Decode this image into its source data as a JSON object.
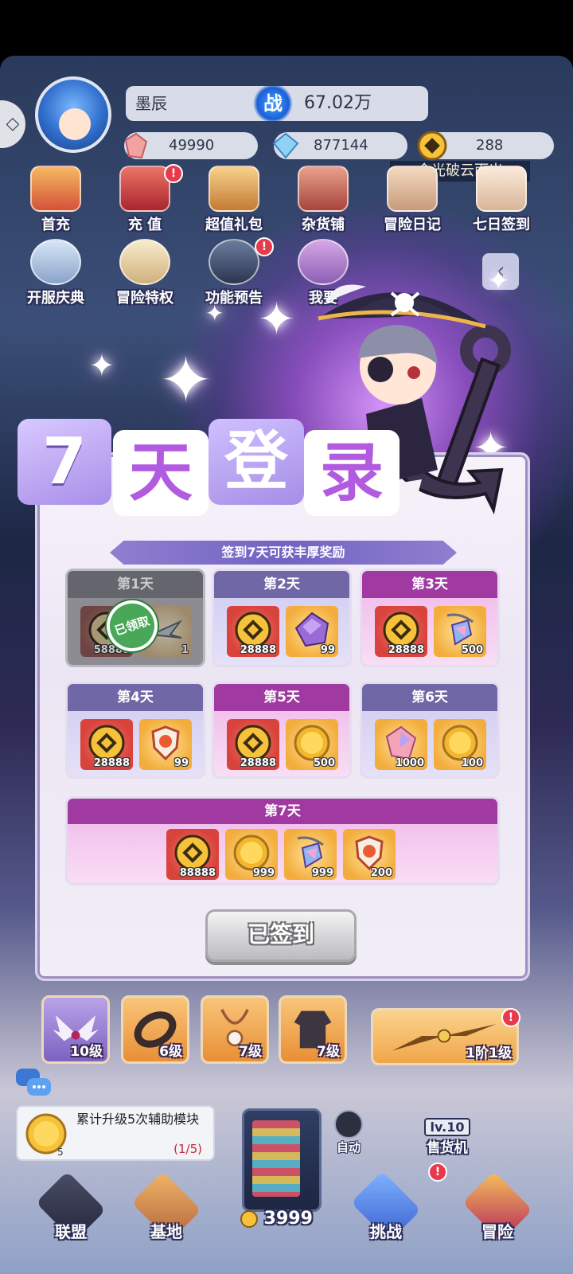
{
  "header": {
    "player_name": "墨辰",
    "power_label": "战",
    "power_value": "67.02万",
    "resources": [
      "49990",
      "877144",
      "288"
    ],
    "title_banner": "金光破云而出"
  },
  "features_row1": [
    "首充",
    "充 值",
    "超值礼包",
    "杂货铺",
    "冒险日记",
    "七日签到"
  ],
  "features_row2": [
    "开服庆典",
    "冒险特权",
    "功能预告",
    "我要"
  ],
  "popup": {
    "title_chars": [
      "7",
      "天",
      "登",
      "录"
    ],
    "subtitle": "签到7天可获丰厚奖励",
    "claimed_stamp": "已领取",
    "days": [
      {
        "label": "第1天",
        "items": [
          {
            "icon": "gold-token-icon",
            "count": "58888"
          },
          {
            "icon": "wing-blade-icon",
            "count": "1"
          }
        ]
      },
      {
        "label": "第2天",
        "items": [
          {
            "icon": "gold-token-icon",
            "count": "28888"
          },
          {
            "icon": "purple-crystal-icon",
            "count": "99"
          }
        ]
      },
      {
        "label": "第3天",
        "items": [
          {
            "icon": "gold-token-icon",
            "count": "28888"
          },
          {
            "icon": "gem-pendant-icon",
            "count": "500"
          }
        ]
      },
      {
        "label": "第4天",
        "items": [
          {
            "icon": "gold-token-icon",
            "count": "28888"
          },
          {
            "icon": "shield-badge-icon",
            "count": "99"
          }
        ]
      },
      {
        "label": "第5天",
        "items": [
          {
            "icon": "gold-token-icon",
            "count": "28888"
          },
          {
            "icon": "gold-coin-icon",
            "count": "500"
          }
        ]
      },
      {
        "label": "第6天",
        "items": [
          {
            "icon": "pink-gem-icon",
            "count": "1000"
          },
          {
            "icon": "gold-coin-icon",
            "count": "100"
          }
        ]
      },
      {
        "label": "第7天",
        "items": [
          {
            "icon": "gold-token-icon",
            "count": "88888"
          },
          {
            "icon": "gold-coin-icon",
            "count": "999"
          },
          {
            "icon": "gem-pendant-icon",
            "count": "999"
          },
          {
            "icon": "shield-badge-icon",
            "count": "200"
          }
        ]
      }
    ],
    "button_label": "已签到"
  },
  "equipment": [
    {
      "name": "wings",
      "level": "10级"
    },
    {
      "name": "bracelet",
      "level": "6级"
    },
    {
      "name": "necklace",
      "level": "7级"
    },
    {
      "name": "armor",
      "level": "7级"
    },
    {
      "name": "gold-wings",
      "level": "1阶1级"
    }
  ],
  "quest": {
    "text": "累计升级5次辅助模块",
    "progress": "(1/5)",
    "reward_count": "5"
  },
  "auto_label": "自动",
  "vending": {
    "level": "lv.10",
    "label": "售货机",
    "coins": "3999"
  },
  "nav": [
    "联盟",
    "基地",
    "挑战",
    "冒险"
  ],
  "colors": {
    "accent_purple": "#a03aa0",
    "lavender": "#6f67a6",
    "alert_red": "#e73a4d"
  }
}
